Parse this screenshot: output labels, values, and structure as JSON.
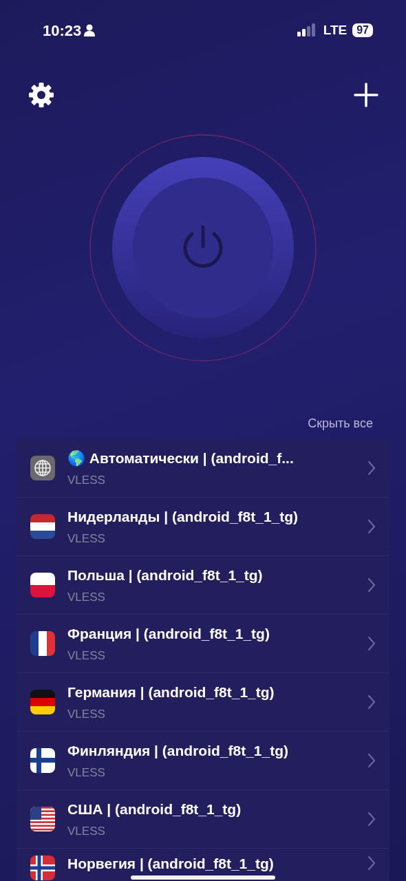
{
  "status_bar": {
    "time": "10:23",
    "network": "LTE",
    "battery": "97"
  },
  "hide_all": "Скрыть все",
  "servers": [
    {
      "title": "🌎 Автоматически | (android_f...",
      "protocol": "VLESS"
    },
    {
      "title": "Нидерланды | (android_f8t_1_tg)",
      "protocol": "VLESS"
    },
    {
      "title": "Польша | (android_f8t_1_tg)",
      "protocol": "VLESS"
    },
    {
      "title": "Франция | (android_f8t_1_tg)",
      "protocol": "VLESS"
    },
    {
      "title": "Германия | (android_f8t_1_tg)",
      "protocol": "VLESS"
    },
    {
      "title": "Финляндия | (android_f8t_1_tg)",
      "protocol": "VLESS"
    },
    {
      "title": "США | (android_f8t_1_tg)",
      "protocol": "VLESS"
    },
    {
      "title": "Норвегия | (android_f8t_1_tg)"
    }
  ]
}
